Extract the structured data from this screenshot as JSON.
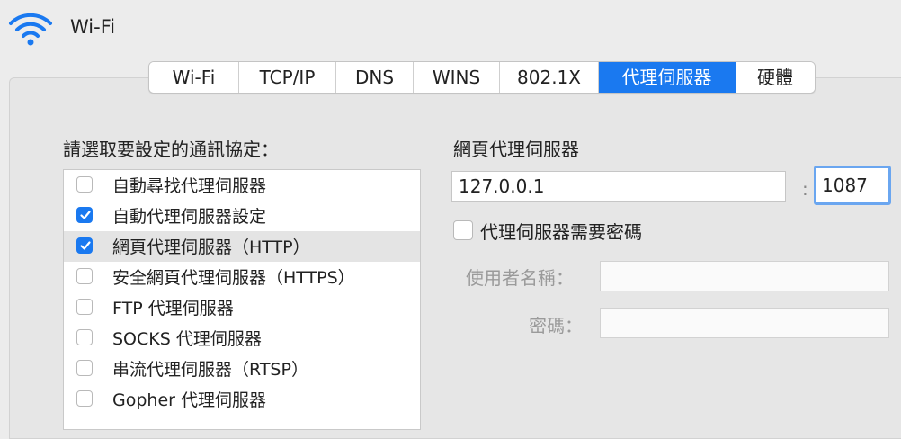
{
  "window": {
    "title": "Wi-Fi"
  },
  "tabs": [
    {
      "label": "Wi-Fi",
      "active": false
    },
    {
      "label": "TCP/IP",
      "active": false
    },
    {
      "label": "DNS",
      "active": false
    },
    {
      "label": "WINS",
      "active": false
    },
    {
      "label": "802.1X",
      "active": false
    },
    {
      "label": "代理伺服器",
      "active": true
    },
    {
      "label": "硬體",
      "active": false
    }
  ],
  "protocols": {
    "heading": "請選取要設定的通訊協定：",
    "items": [
      {
        "label": "自動尋找代理伺服器",
        "checked": false,
        "selected": false
      },
      {
        "label": "自動代理伺服器設定",
        "checked": true,
        "selected": false
      },
      {
        "label": "網頁代理伺服器（HTTP）",
        "checked": true,
        "selected": true
      },
      {
        "label": "安全網頁代理伺服器（HTTPS）",
        "checked": false,
        "selected": false
      },
      {
        "label": "FTP 代理伺服器",
        "checked": false,
        "selected": false
      },
      {
        "label": "SOCKS 代理伺服器",
        "checked": false,
        "selected": false
      },
      {
        "label": "串流代理伺服器（RTSP）",
        "checked": false,
        "selected": false
      },
      {
        "label": "Gopher 代理伺服器",
        "checked": false,
        "selected": false
      }
    ]
  },
  "proxy": {
    "heading": "網頁代理伺服器",
    "server_value": "127.0.0.1",
    "port_separator": ":",
    "port_value": "1087",
    "auth_label": "代理伺服器需要密碼",
    "auth_checked": false,
    "username_label": "使用者名稱：",
    "username_value": "",
    "password_label": "密碼：",
    "password_value": ""
  },
  "colors": {
    "accent": "#1a79f0",
    "background": "#ececec",
    "disabled_text": "#9a9a9a"
  },
  "icons": {
    "window": "wifi-icon",
    "check": "checkmark-icon"
  }
}
